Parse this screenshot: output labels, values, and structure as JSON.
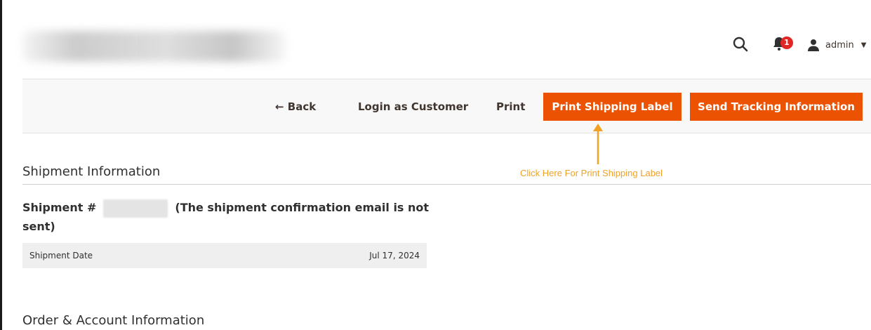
{
  "header": {
    "notification_count": "1",
    "user_name": "admin",
    "icons": {
      "search": "search-icon",
      "bell": "bell-icon",
      "user": "user-icon",
      "caret": "caret-down-icon"
    }
  },
  "actions": {
    "back_label": "← Back",
    "login_label": "Login as Customer",
    "print_label": "Print",
    "print_shipping_label": "Print Shipping Label",
    "send_tracking_label": "Send Tracking Information"
  },
  "annotation": {
    "text": "Click Here For Print Shipping Label",
    "color": "#f0a126"
  },
  "shipment_info": {
    "section_title": "Shipment Information",
    "heading_prefix": "Shipment #",
    "heading_suffix": "(The shipment confirmation email is not sent)",
    "rows": [
      {
        "label": "Shipment Date",
        "value": "Jul 17, 2024"
      }
    ]
  },
  "order_account": {
    "section_title": "Order & Account Information"
  },
  "colors": {
    "accent": "#eb5202",
    "badge": "#e22626"
  }
}
